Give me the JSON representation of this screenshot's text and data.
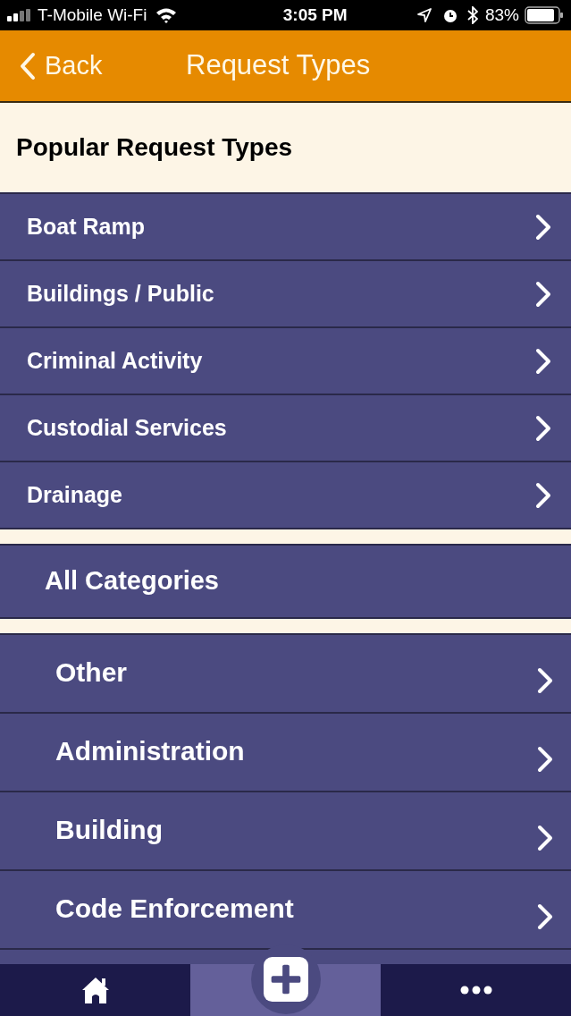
{
  "status_bar": {
    "carrier": "T-Mobile Wi-Fi",
    "time": "3:05 PM",
    "battery": "83%"
  },
  "nav": {
    "back": "Back",
    "title": "Request Types"
  },
  "popular": {
    "heading": "Popular Request Types",
    "items": [
      {
        "label": "Boat Ramp"
      },
      {
        "label": "Buildings / Public"
      },
      {
        "label": "Criminal Activity"
      },
      {
        "label": "Custodial Services"
      },
      {
        "label": "Drainage"
      }
    ]
  },
  "all_categories": {
    "heading": "All Categories",
    "items": [
      {
        "label": "Other"
      },
      {
        "label": "Administration"
      },
      {
        "label": "Building"
      },
      {
        "label": "Code Enforcement"
      }
    ]
  },
  "tab_bar": [
    {
      "kind": "home",
      "selected": false
    },
    {
      "kind": "add",
      "selected": true
    },
    {
      "kind": "more",
      "selected": false
    }
  ]
}
